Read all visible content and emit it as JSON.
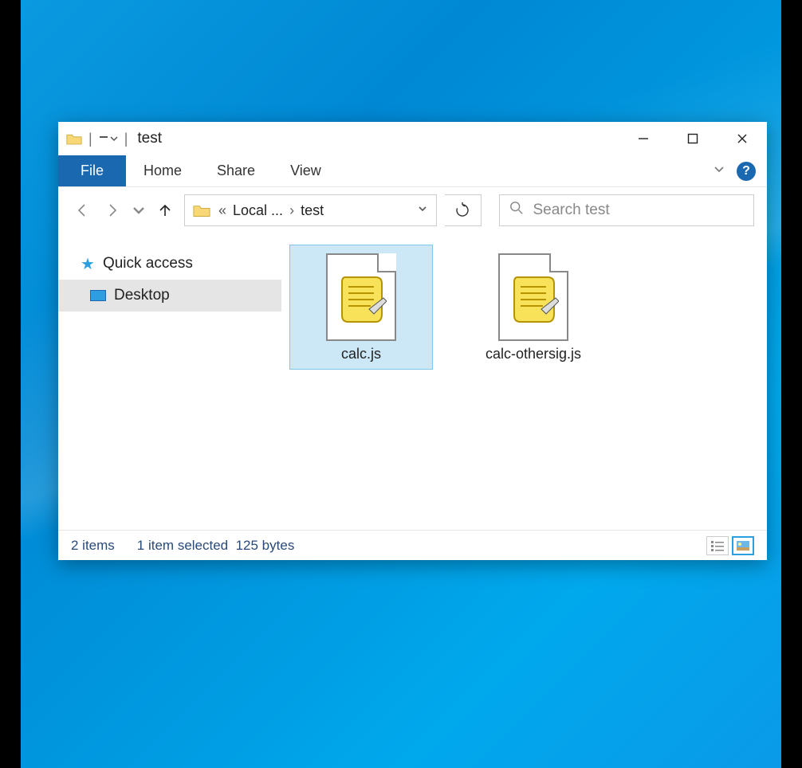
{
  "title": "test",
  "ribbon": {
    "file": "File",
    "home": "Home",
    "share": "Share",
    "view": "View"
  },
  "breadcrumb": {
    "parent": "Local ...",
    "current": "test"
  },
  "search": {
    "placeholder": "Search test"
  },
  "sidebar": {
    "items": [
      {
        "label": "Quick access"
      },
      {
        "label": "Desktop"
      }
    ]
  },
  "files": [
    {
      "name": "calc.js",
      "selected": true
    },
    {
      "name": "calc-othersig.js",
      "selected": false
    }
  ],
  "status": {
    "count": "2 items",
    "selection": "1 item selected",
    "size": "125 bytes"
  }
}
